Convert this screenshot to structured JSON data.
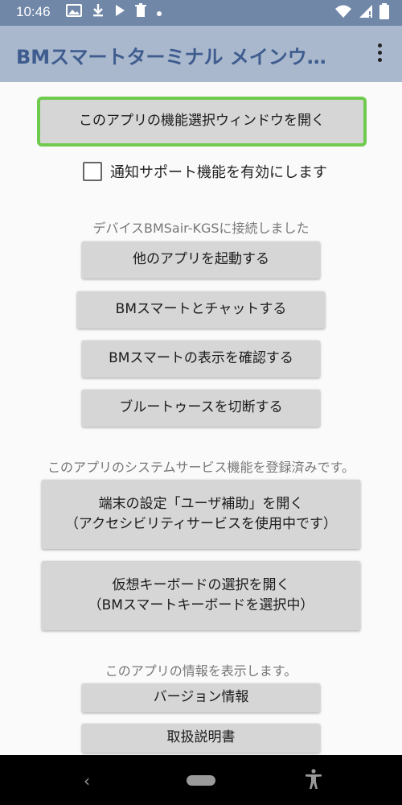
{
  "status_bar": {
    "time": "10:46",
    "icons": [
      "gallery-icon",
      "download-icon",
      "play-icon",
      "trash-icon",
      "dot-icon",
      "wifi-icon",
      "signal-icon",
      "battery-icon"
    ],
    "background": "#7087a8"
  },
  "app_bar": {
    "title": "BMスマートターミナル メインウ…",
    "background": "#a9b8cd",
    "title_color": "#3f5c8f"
  },
  "main": {
    "open_feature_window_button": "このアプリの機能選択ウィンドウを開く",
    "notification_support_checkbox": {
      "label": "通知サポート機能を有効にします",
      "checked": false
    },
    "device_section": {
      "label": "デバイスBMSair-KGSに接続しました",
      "buttons": [
        "他のアプリを起動する",
        "BMスマートとチャットする",
        "BMスマートの表示を確認する",
        "ブルートゥースを切断する"
      ]
    },
    "service_section": {
      "label": "このアプリのシステムサービス機能を登録済みです。",
      "accessibility_button": "端末の設定「ユーザ補助」を開く\n（アクセシビリティサービスを使用中です）",
      "keyboard_button": "仮想キーボードの選択を開く\n（BMスマートキーボードを選択中）"
    },
    "info_section": {
      "label": "このアプリの情報を表示します。",
      "buttons": [
        "バージョン情報",
        "取扱説明書"
      ]
    },
    "highlight_color": "#6fcb4e"
  },
  "nav_bar": {
    "back_symbol": "‹",
    "icons": [
      "back-icon",
      "home-pill-icon",
      "accessibility-icon"
    ]
  }
}
